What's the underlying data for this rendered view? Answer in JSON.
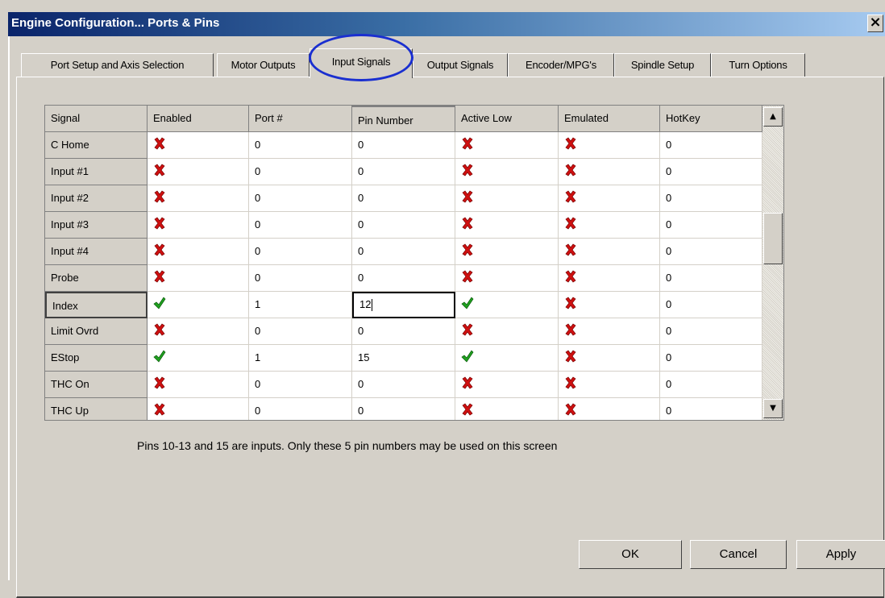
{
  "window": {
    "title": "Engine Configuration... Ports & Pins",
    "close_label": "×"
  },
  "tabs": [
    {
      "label": "Port Setup and Axis Selection"
    },
    {
      "label": "Motor Outputs"
    },
    {
      "label": "Input Signals"
    },
    {
      "label": "Output Signals"
    },
    {
      "label": "Encoder/MPG's"
    },
    {
      "label": "Spindle Setup"
    },
    {
      "label": "Turn Options"
    }
  ],
  "active_tab": "Input Signals",
  "grid": {
    "columns": [
      "Signal",
      "Enabled",
      "Port #",
      "Pin Number",
      "Active Low",
      "Emulated",
      "HotKey"
    ],
    "rows": [
      {
        "signal": "C Home",
        "enabled": "x-icon",
        "port": "0",
        "pin": "0",
        "active_low": "x-icon",
        "emulated": "x-icon",
        "hotkey": "0"
      },
      {
        "signal": "Input #1",
        "enabled": "x-icon",
        "port": "0",
        "pin": "0",
        "active_low": "x-icon",
        "emulated": "x-icon",
        "hotkey": "0"
      },
      {
        "signal": "Input #2",
        "enabled": "x-icon",
        "port": "0",
        "pin": "0",
        "active_low": "x-icon",
        "emulated": "x-icon",
        "hotkey": "0"
      },
      {
        "signal": "Input #3",
        "enabled": "x-icon",
        "port": "0",
        "pin": "0",
        "active_low": "x-icon",
        "emulated": "x-icon",
        "hotkey": "0"
      },
      {
        "signal": "Input #4",
        "enabled": "x-icon",
        "port": "0",
        "pin": "0",
        "active_low": "x-icon",
        "emulated": "x-icon",
        "hotkey": "0"
      },
      {
        "signal": "Probe",
        "enabled": "x-icon",
        "port": "0",
        "pin": "0",
        "active_low": "x-icon",
        "emulated": "x-icon",
        "hotkey": "0"
      },
      {
        "signal": "Index",
        "enabled": "check-icon",
        "port": "1",
        "pin": "12",
        "active_low": "check-icon",
        "emulated": "x-icon",
        "hotkey": "0"
      },
      {
        "signal": "Limit Ovrd",
        "enabled": "x-icon",
        "port": "0",
        "pin": "0",
        "active_low": "x-icon",
        "emulated": "x-icon",
        "hotkey": "0"
      },
      {
        "signal": "EStop",
        "enabled": "check-icon",
        "port": "1",
        "pin": "15",
        "active_low": "check-icon",
        "emulated": "x-icon",
        "hotkey": "0"
      },
      {
        "signal": "THC On",
        "enabled": "x-icon",
        "port": "0",
        "pin": "0",
        "active_low": "x-icon",
        "emulated": "x-icon",
        "hotkey": "0"
      },
      {
        "signal": "THC Up",
        "enabled": "x-icon",
        "port": "0",
        "pin": "0",
        "active_low": "x-icon",
        "emulated": "x-icon",
        "hotkey": "0"
      }
    ],
    "scroll_up_icon": "scroll-up-arrow-icon",
    "scroll_down_icon": "scroll-down-arrow-icon"
  },
  "note": "Pins 10-13 and 15 are inputs. Only these 5 pin numbers may be used on this screen",
  "buttons": {
    "ok": "OK",
    "cancel": "Cancel",
    "apply": "Apply"
  },
  "colors": {
    "titlebar_start": "#0a246a",
    "x_icon": "#d01010",
    "check_icon": "#20a020",
    "highlight_circle": "#1a2fd0"
  }
}
